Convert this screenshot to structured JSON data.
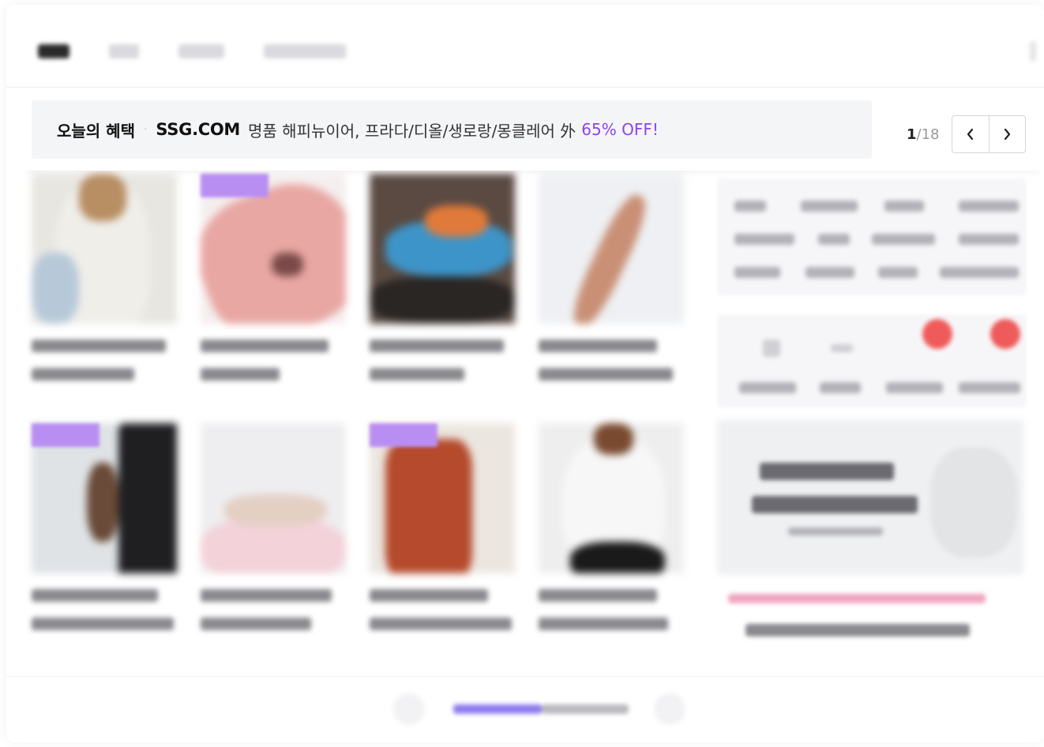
{
  "banner": {
    "label": "오늘의 혜택",
    "separator": "·",
    "brand": "SSG.COM",
    "description": "명품 해피뉴이어, 프라다/디올/생로랑/몽클레어 外",
    "discount": "65% OFF!",
    "page_current": "1",
    "page_total": "/18",
    "prev_icon": "chevron-left-icon",
    "next_icon": "chevron-right-icon",
    "prev_glyph": "‹",
    "next_glyph": "›"
  },
  "colors": {
    "accent_purple": "#8e44e8",
    "banner_bg": "#f4f5f7",
    "badge_purple": "#b98ef2",
    "notify_red": "#ef5a5a"
  }
}
